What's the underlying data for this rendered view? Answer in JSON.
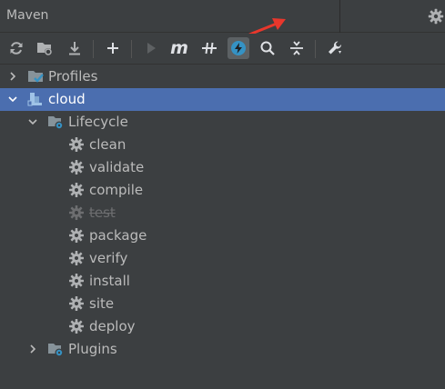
{
  "header": {
    "title": "Maven"
  },
  "toolbar": {
    "buttons": [
      {
        "name": "reload-icon"
      },
      {
        "name": "generate-sources-icon"
      },
      {
        "name": "download-icon"
      },
      {
        "name": "add-icon"
      },
      {
        "name": "run-icon"
      },
      {
        "name": "execute-goal-icon",
        "text": "m"
      },
      {
        "name": "toggle-offline-icon"
      },
      {
        "name": "skip-tests-icon"
      },
      {
        "name": "search-icon"
      },
      {
        "name": "collapse-all-icon"
      },
      {
        "name": "wrench-icon"
      }
    ]
  },
  "tree": {
    "profiles": "Profiles",
    "project": "cloud",
    "lifecycle": "Lifecycle",
    "goals": [
      "clean",
      "validate",
      "compile",
      "test",
      "package",
      "verify",
      "install",
      "site",
      "deploy"
    ],
    "plugins": "Plugins"
  },
  "colors": {
    "background": "#3c3f41",
    "selection": "#4b6eaf",
    "text": "#bbbbbb",
    "disabled_text": "#6d6e70",
    "active_button": "#5c6164",
    "annotation_arrow": "#e8372c"
  }
}
